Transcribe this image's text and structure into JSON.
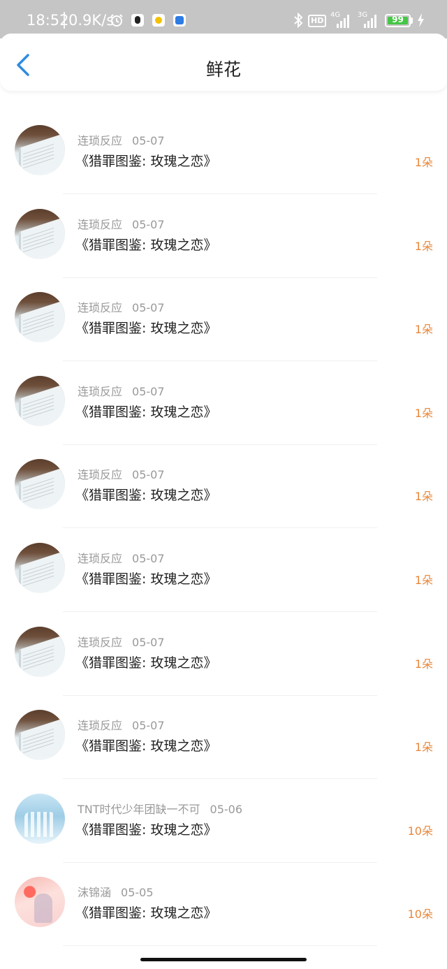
{
  "status_bar": {
    "time": "18:52",
    "net_speed": "0.9K/s",
    "hd_label": "HD",
    "sim1_network": "4G",
    "sim2_network": "3G",
    "battery_level": "99",
    "icons": [
      "alarm-icon",
      "qq-icon",
      "baidu-icon",
      "app-store-icon",
      "bluetooth-icon",
      "signal-icon",
      "battery-icon",
      "charging-icon"
    ],
    "battery_color": "#46c646"
  },
  "header": {
    "title": "鲜花",
    "back_icon": "chevron-left-icon",
    "accent_color": "#2d8ce0"
  },
  "list": {
    "count_color": "#e8873b",
    "items": [
      {
        "user": "连琐反应",
        "date": "05-07",
        "work": "《猎罪图鉴: 玫瑰之恋》",
        "count": "1朵",
        "avatar": "book"
      },
      {
        "user": "连琐反应",
        "date": "05-07",
        "work": "《猎罪图鉴: 玫瑰之恋》",
        "count": "1朵",
        "avatar": "book"
      },
      {
        "user": "连琐反应",
        "date": "05-07",
        "work": "《猎罪图鉴: 玫瑰之恋》",
        "count": "1朵",
        "avatar": "book"
      },
      {
        "user": "连琐反应",
        "date": "05-07",
        "work": "《猎罪图鉴: 玫瑰之恋》",
        "count": "1朵",
        "avatar": "book"
      },
      {
        "user": "连琐反应",
        "date": "05-07",
        "work": "《猎罪图鉴: 玫瑰之恋》",
        "count": "1朵",
        "avatar": "book"
      },
      {
        "user": "连琐反应",
        "date": "05-07",
        "work": "《猎罪图鉴: 玫瑰之恋》",
        "count": "1朵",
        "avatar": "book"
      },
      {
        "user": "连琐反应",
        "date": "05-07",
        "work": "《猎罪图鉴: 玫瑰之恋》",
        "count": "1朵",
        "avatar": "book"
      },
      {
        "user": "连琐反应",
        "date": "05-07",
        "work": "《猎罪图鉴: 玫瑰之恋》",
        "count": "1朵",
        "avatar": "book"
      },
      {
        "user": "TNT时代少年团缺一不可",
        "date": "05-06",
        "work": "《猎罪图鉴: 玫瑰之恋》",
        "count": "10朵",
        "avatar": "group"
      },
      {
        "user": "沫锦涵",
        "date": "05-05",
        "work": "《猎罪图鉴: 玫瑰之恋》",
        "count": "10朵",
        "avatar": "sunset"
      }
    ]
  }
}
